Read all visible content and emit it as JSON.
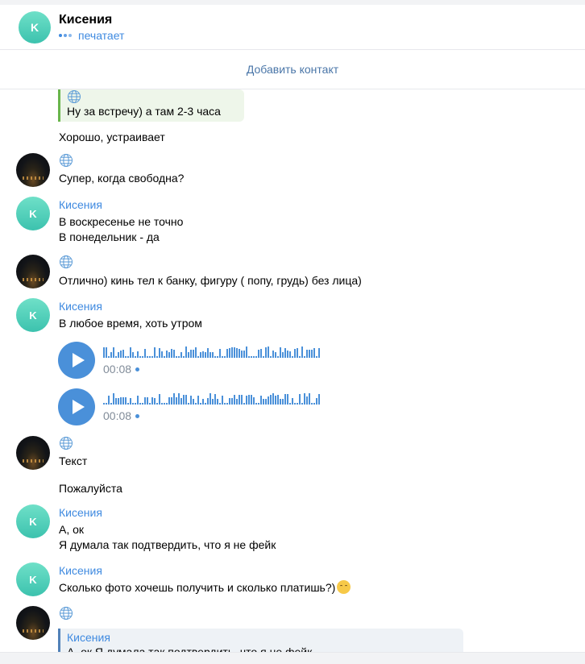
{
  "header": {
    "contact_name": "Кисения",
    "avatar_letter": "K",
    "status": "печатает"
  },
  "add_contact": "Добавить контакт",
  "messages": {
    "m0_quote": "Ну за встречу) а там 2-3 часа",
    "m1": "Хорошо, устраивает",
    "m2": "Супер, когда свободна?",
    "m3_sender": "Кисения",
    "m3_line1": "В воскресенье не точно",
    "m3_line2": "В понедельник - да",
    "m4": "Отлично) кинь тел к банку, фигуру ( попу, грудь) без лица)",
    "m5_sender": "Кисения",
    "m5": "В любое время, хоть утром",
    "voice1_time": "00:08",
    "voice2_time": "00:08",
    "m6": "Текст",
    "m7": "Пожалуйста",
    "m8_sender": "Кисения",
    "m8_line1": "А, ок",
    "m8_line2": "Я думала так подтвердить, что я не фейк",
    "m9_sender": "Кисения",
    "m9": "Сколько фото хочешь получить и сколько платишь?)",
    "m10_reply_name": "Кисения",
    "m10_reply_text": "А, ок Я думала так подтвердить, что я не фейк"
  },
  "icons": {
    "globe": "globe-icon",
    "play": "play-icon",
    "emoji": "relieved-face-emoji"
  },
  "colors": {
    "accent": "#3f8ae0",
    "play_button": "#4a90d9",
    "avatar_teal": "#4cd0b8",
    "quote_green": "#69b54b",
    "reply_blue": "#5181b8"
  }
}
